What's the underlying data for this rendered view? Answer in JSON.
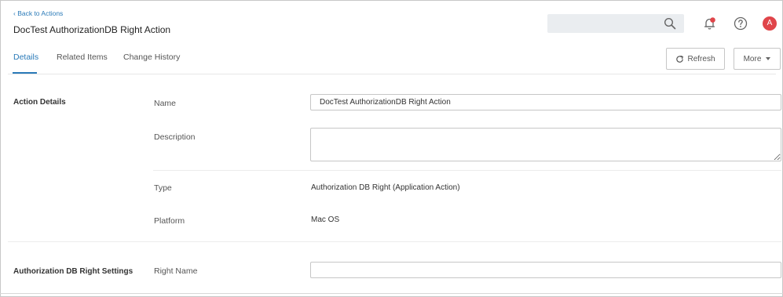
{
  "header": {
    "back_link": "‹ Back to Actions",
    "title": "DocTest AuthorizationDB Right Action",
    "search_placeholder": "",
    "avatar_initial": "A",
    "icons": [
      "search-icon",
      "bell-icon",
      "help-icon"
    ],
    "colors": {
      "accent": "#2a7ab8",
      "notification": "#e0454a",
      "avatar": "#e0454a"
    }
  },
  "tabs": [
    {
      "label": "Details",
      "active": true
    },
    {
      "label": "Related Items",
      "active": false
    },
    {
      "label": "Change History",
      "active": false
    }
  ],
  "toolbar": {
    "refresh_label": "Refresh",
    "more_label": "More"
  },
  "action_details": {
    "section_title": "Action Details",
    "name_label": "Name",
    "name_value": "DocTest AuthorizationDB Right Action",
    "description_label": "Description",
    "description_value": "",
    "type_label": "Type",
    "type_value": "Authorization DB Right (Application Action)",
    "platform_label": "Platform",
    "platform_value": "Mac OS"
  },
  "right_settings": {
    "section_title": "Authorization DB Right Settings",
    "right_name_label": "Right Name",
    "right_name_value": ""
  }
}
